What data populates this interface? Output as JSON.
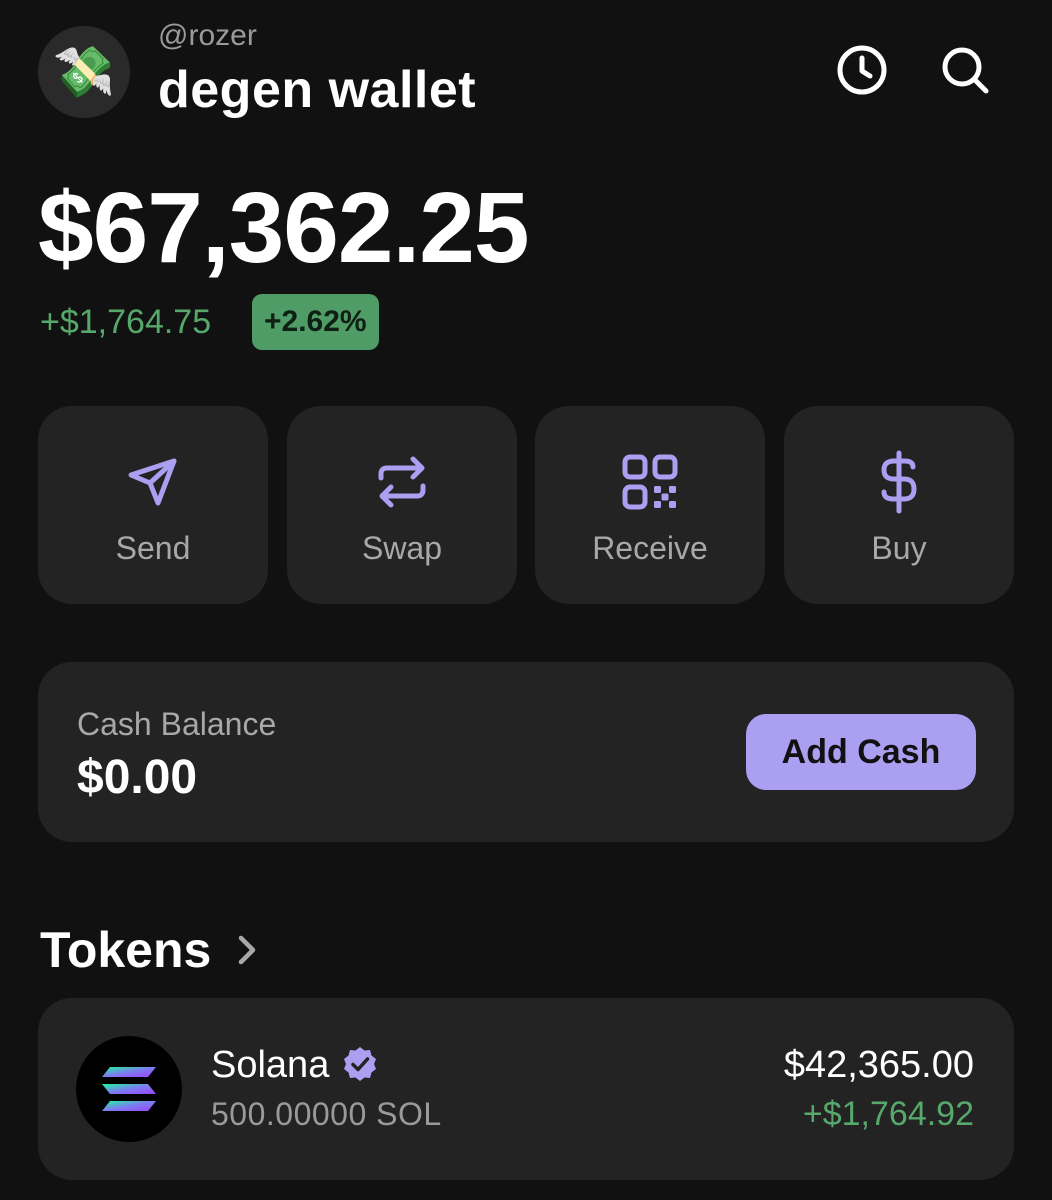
{
  "header": {
    "avatar_emoji": "💸",
    "handle": "@rozer",
    "wallet_name": "degen wallet",
    "icons": [
      "clock-icon",
      "search-icon"
    ]
  },
  "balance": {
    "total": "$67,362.25",
    "change_amount": "+$1,764.75",
    "change_percent": "+2.62%"
  },
  "actions": [
    {
      "label": "Send",
      "icon": "send-icon"
    },
    {
      "label": "Swap",
      "icon": "swap-icon"
    },
    {
      "label": "Receive",
      "icon": "qr-code-icon"
    },
    {
      "label": "Buy",
      "icon": "dollar-icon"
    }
  ],
  "cash": {
    "label": "Cash Balance",
    "value": "$0.00",
    "button_label": "Add Cash"
  },
  "tokens": {
    "title": "Tokens",
    "items": [
      {
        "name": "Solana",
        "amount": "500.00000 SOL",
        "value": "$42,365.00",
        "change": "+$1,764.92",
        "verified": true
      }
    ]
  },
  "colors": {
    "background": "#111111",
    "card": "#232323",
    "accent": "#ab9ff2",
    "positive": "#56a86b",
    "badge": "#4f9c67"
  }
}
